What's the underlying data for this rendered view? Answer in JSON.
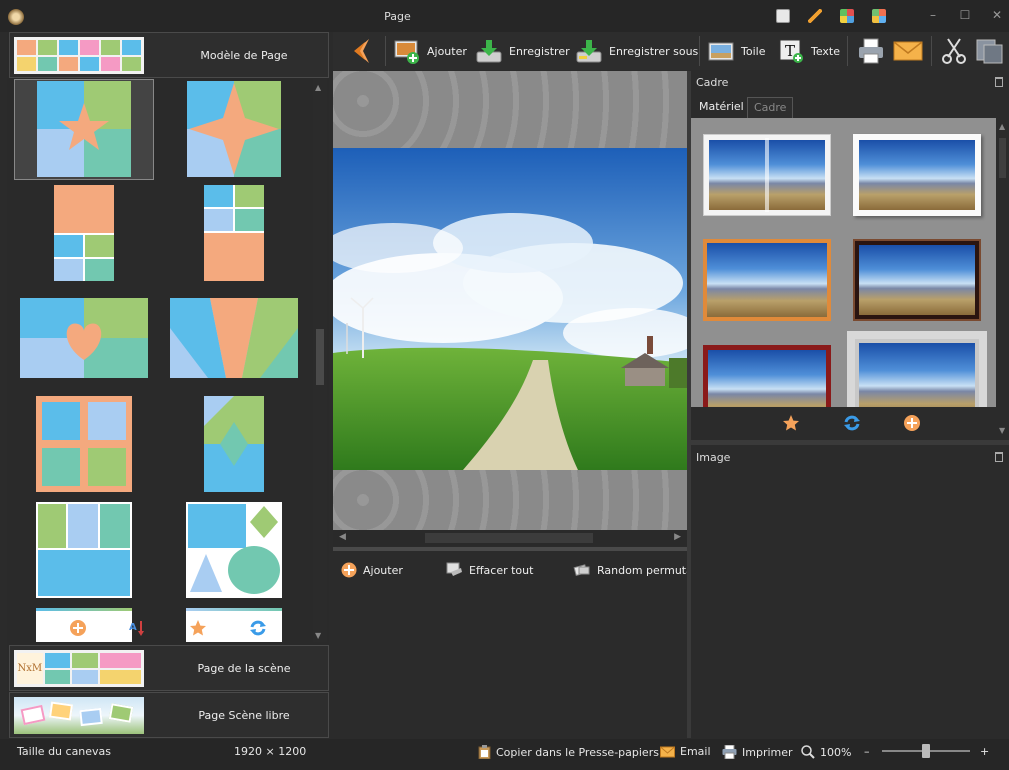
{
  "window": {
    "title": "Page",
    "controls": {
      "minimize": "–",
      "maximize": "☐",
      "close": "✕"
    }
  },
  "left_panel": {
    "sections": [
      {
        "label": "Modèle de Page"
      },
      {
        "label": "Page de la scène",
        "thumb_text": "NxM"
      },
      {
        "label": "Page Scène libre"
      }
    ]
  },
  "toolbar": {
    "items": [
      {
        "label": "Ajouter",
        "icon": "add-image-icon"
      },
      {
        "label": "Enregistrer",
        "icon": "save-icon"
      },
      {
        "label": "Enregistrer sous",
        "icon": "save-as-icon"
      },
      {
        "label": "Toile",
        "icon": "canvas-icon"
      },
      {
        "label": "Texte",
        "icon": "text-icon"
      }
    ]
  },
  "canvas_actions": {
    "add": "Ajouter",
    "clear_all": "Effacer tout",
    "random": "Random permuta"
  },
  "right_panel": {
    "cadre_title": "Cadre",
    "tabs": [
      "Matériel",
      "Cadre"
    ],
    "active_tab": 0,
    "image_title": "Image"
  },
  "statusbar": {
    "canvas_size_label": "Taille du canevas",
    "canvas_size_value": "1920 × 1200",
    "copy": "Copier dans le Presse-papiers",
    "email": "Email",
    "print": "Imprimer",
    "zoom": "100%",
    "zoom_minus": "–",
    "zoom_plus": "+",
    "zoom_level": 0.5
  },
  "colors": {
    "accent_orange": "#f5a25a",
    "layout_blue": "#5bbdea",
    "layout_green": "#9fca74",
    "layout_teal": "#72c8b0",
    "layout_peach": "#f4a97e",
    "layout_lightblue": "#a9cdf2"
  }
}
